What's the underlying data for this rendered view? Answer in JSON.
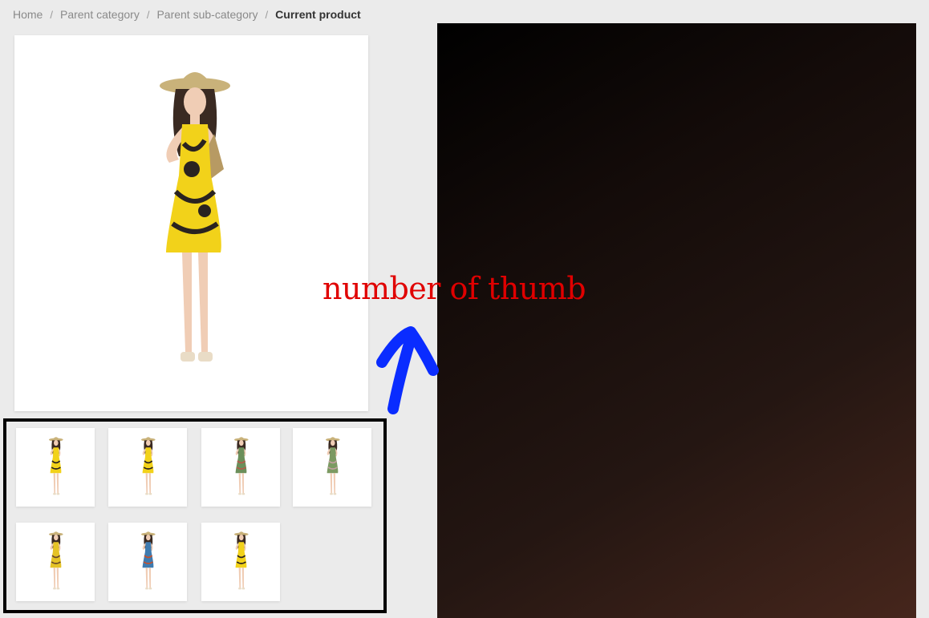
{
  "breadcrumb": {
    "items": [
      "Home",
      "Parent category",
      "Parent sub-category"
    ],
    "separator": "/",
    "current": "Current product"
  },
  "thumbnails": [
    {
      "dress": "#f2d21a",
      "accent": "#2a2320"
    },
    {
      "dress": "#f2d21a",
      "accent": "#2a2320"
    },
    {
      "dress": "#6b8f5a",
      "accent": "#b65a4a"
    },
    {
      "dress": "#7c9a62",
      "accent": "#c2a0a0"
    },
    {
      "dress": "#e5c326",
      "accent": "#6a4a2a"
    },
    {
      "dress": "#3e7bb0",
      "accent": "#c8502a"
    },
    {
      "dress": "#f2d21a",
      "accent": "#2a2320"
    }
  ],
  "annotation": {
    "text": "number of thumb",
    "color": "#e00000",
    "arrow_color": "#0a2cff"
  },
  "colors": {
    "background": "#ebebeb",
    "panel_dark": "#000000",
    "panel_warm": "#46261c"
  }
}
